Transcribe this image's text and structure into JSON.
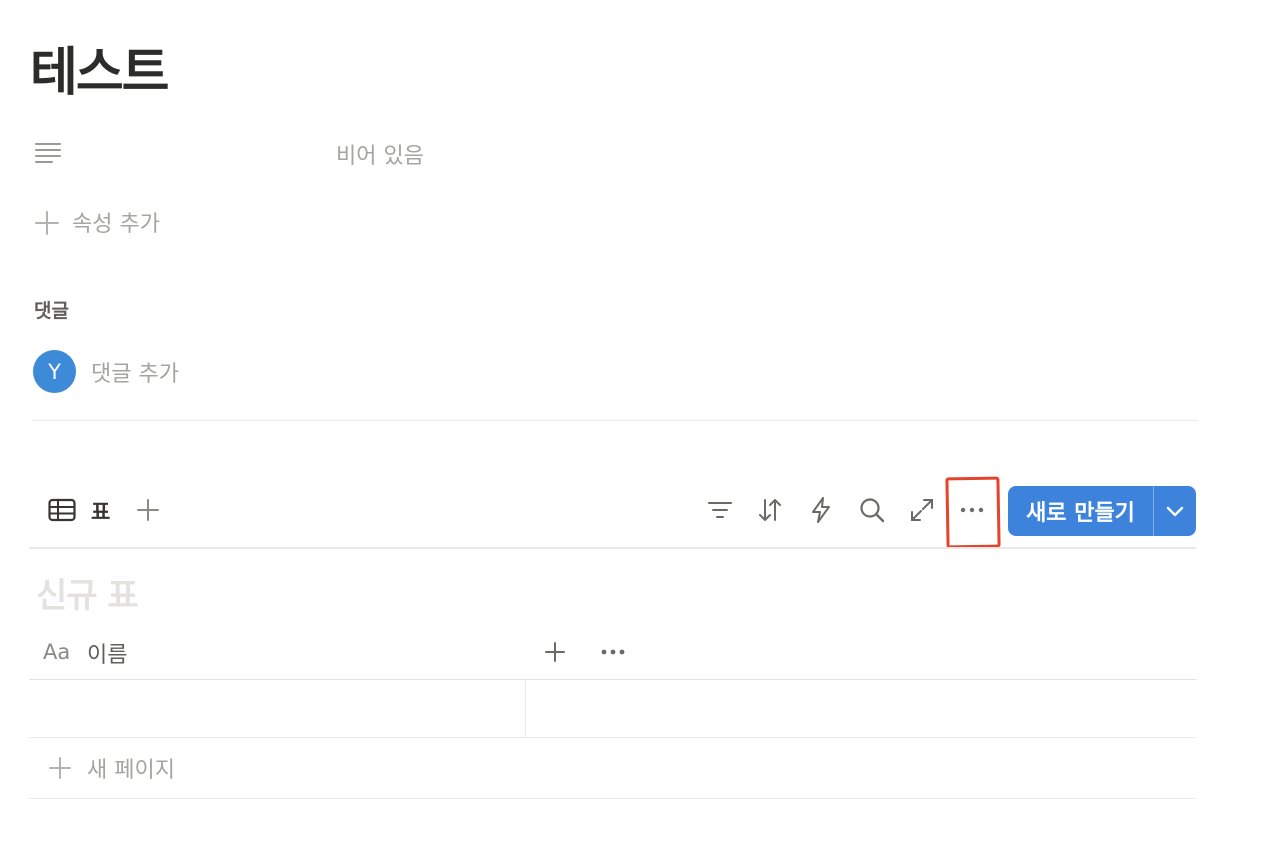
{
  "page": {
    "title": "테스트"
  },
  "properties": {
    "description_value": "비어 있음",
    "add_property_label": "속성 추가"
  },
  "comments": {
    "heading": "댓글",
    "avatar_initial": "Y",
    "placeholder": "댓글 추가",
    "avatar_color": "#3d8ad8"
  },
  "database": {
    "view_tab_label": "표",
    "new_button_label": "새로 만들기",
    "table_title": "신규 표",
    "columns": [
      {
        "type_label": "Aa",
        "name": "이름"
      }
    ],
    "new_page_label": "새 페이지",
    "accent_color": "#3d83dc",
    "highlight_color": "#e5432b",
    "toolbar_icons": [
      "filter-icon",
      "sort-icon",
      "automation-icon",
      "search-icon",
      "expand-icon",
      "more-options-icon"
    ]
  }
}
